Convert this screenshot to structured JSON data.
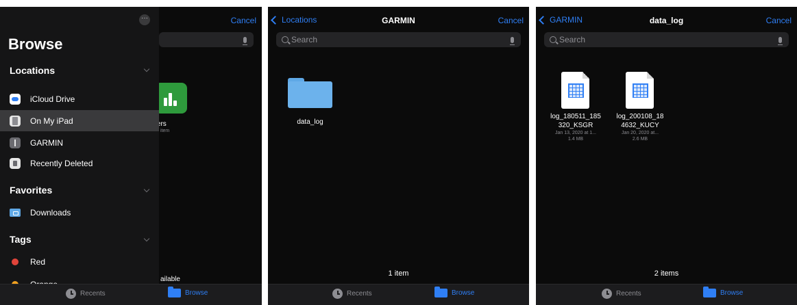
{
  "panel1": {
    "cancel_label": "Cancel",
    "more_label": "···",
    "sidebar": {
      "title": "Browse",
      "sections": {
        "locations": "Locations",
        "favorites": "Favorites",
        "tags": "Tags"
      },
      "locations": [
        {
          "label": "iCloud Drive",
          "icon": "icloud-icon"
        },
        {
          "label": "On My iPad",
          "icon": "ipad-icon"
        },
        {
          "label": "GARMIN",
          "icon": "usb-icon"
        },
        {
          "label": "Recently Deleted",
          "icon": "trash-icon"
        }
      ],
      "favorites": [
        {
          "label": "Downloads",
          "icon": "downloads-folder-icon"
        }
      ],
      "tags": [
        {
          "label": "Red",
          "color": "#e0443a"
        },
        {
          "label": "Orange",
          "color": "#f0a020"
        }
      ]
    },
    "background": {
      "item_label_partial": "mbers",
      "item_sub_partial": "item",
      "status_partial": "ailable"
    },
    "tabbar": {
      "recents": "Recents",
      "browse": "Browse"
    }
  },
  "panel2": {
    "back_label": "Locations",
    "title": "GARMIN",
    "cancel_label": "Cancel",
    "search_placeholder": "Search",
    "folder": {
      "name": "data_log"
    },
    "count": "1 item",
    "tabbar": {
      "recents": "Recents",
      "browse": "Browse"
    }
  },
  "panel3": {
    "back_label": "GARMIN",
    "title": "data_log",
    "cancel_label": "Cancel",
    "search_placeholder": "Search",
    "files": [
      {
        "name_line1": "log_180511_185",
        "name_line2": "320_KSGR",
        "date": "Jan 13, 2020 at 1...",
        "size": "1.4 MB"
      },
      {
        "name_line1": "log_200108_18",
        "name_line2": "4632_KUCY",
        "date": "Jan 20, 2020 at...",
        "size": "2.6 MB"
      }
    ],
    "count": "2 items",
    "tabbar": {
      "recents": "Recents",
      "browse": "Browse"
    }
  },
  "colors": {
    "accent": "#2f7ff5",
    "background": "#0b0b0b",
    "sidebar_bg": "#151516",
    "selected_row": "#3a3a3c"
  }
}
